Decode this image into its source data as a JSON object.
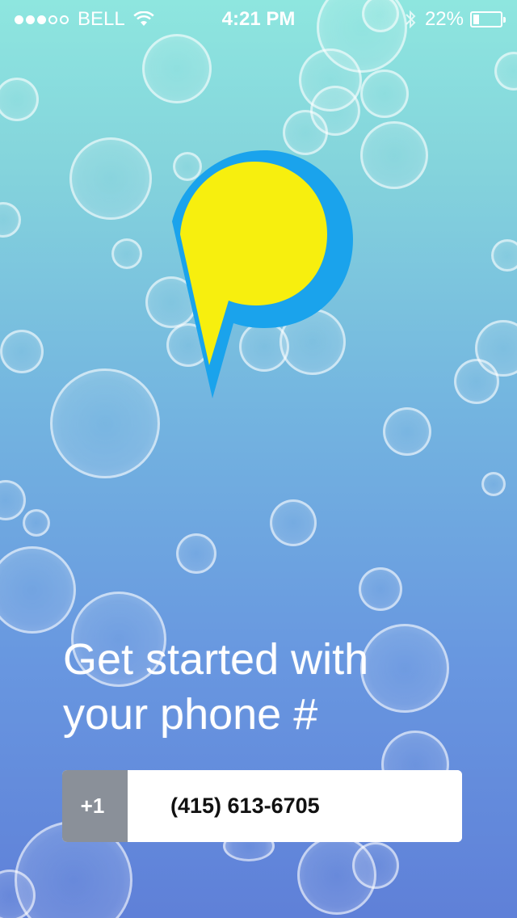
{
  "status_bar": {
    "signal_icon": "signal-dots-icon",
    "carrier": "BELL",
    "wifi_icon": "wifi-icon",
    "time": "4:21 PM",
    "bluetooth_icon": "bluetooth-icon",
    "battery_percent": "22%",
    "battery_level": 0.22,
    "battery_icon": "battery-icon"
  },
  "logo": {
    "icon": "speech-bubble-logo-icon",
    "colors": {
      "fill": "#f7ef0e",
      "outline": "#1aa3ec"
    }
  },
  "headline": {
    "line1": "Get started with",
    "line2": "your phone #"
  },
  "phone_input": {
    "country_code": "+1",
    "value": "(415) 613-6705"
  },
  "colors": {
    "background_top": "#8ee6df",
    "background_bottom": "#5f80d8",
    "country_code_bg": "#8a9099"
  }
}
